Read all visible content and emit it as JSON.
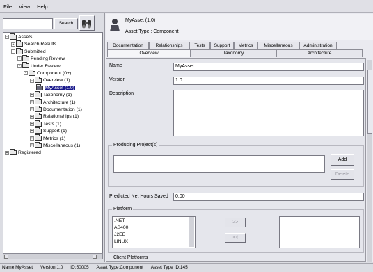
{
  "menu": [
    "File",
    "View",
    "Help"
  ],
  "search": {
    "button_label": "Search",
    "value": ""
  },
  "tree": [
    {
      "label": "Assets",
      "level": 0,
      "expander": "-"
    },
    {
      "label": "Search Results",
      "level": 1,
      "expander": "+"
    },
    {
      "label": "Submitted",
      "level": 1,
      "expander": "-"
    },
    {
      "label": "Pending Review",
      "level": 2,
      "expander": "+"
    },
    {
      "label": "Under Review",
      "level": 2,
      "expander": "-"
    },
    {
      "label": "Component (0+)",
      "level": 3,
      "expander": "-"
    },
    {
      "label": "Overview (1)",
      "level": 4,
      "expander": "-"
    },
    {
      "label": "MyAsset (1.0)",
      "level": 5,
      "expander": "",
      "selected": true
    },
    {
      "label": "Taxonomy (1)",
      "level": 4,
      "expander": "+"
    },
    {
      "label": "Architecture (1)",
      "level": 4,
      "expander": "+"
    },
    {
      "label": "Documentation (1)",
      "level": 4,
      "expander": "+"
    },
    {
      "label": "Relationships (1)",
      "level": 4,
      "expander": "+"
    },
    {
      "label": "Tests (1)",
      "level": 4,
      "expander": "+"
    },
    {
      "label": "Support (1)",
      "level": 4,
      "expander": "+"
    },
    {
      "label": "Metrics (1)",
      "level": 4,
      "expander": "+"
    },
    {
      "label": "Miscellaneous (1)",
      "level": 4,
      "expander": "+"
    },
    {
      "label": "Registered",
      "level": 0,
      "expander": "+"
    }
  ],
  "asset": {
    "title": "MyAsset (1.0)",
    "type_line": "Asset Type : Component"
  },
  "tabs_back": [
    "Documentation",
    "Relationships",
    "Tests",
    "Support",
    "Metrics",
    "Miscellaneous",
    "Administration"
  ],
  "tabs_front": [
    "Overview",
    "Taxonomy",
    "Architecture"
  ],
  "form": {
    "name_label": "Name",
    "name_value": "MyAsset",
    "version_label": "Version",
    "version_value": "1.0",
    "description_label": "Description",
    "description_value": "",
    "projects_label": "Producing Project(s)",
    "add_label": "Add",
    "delete_label": "Delete",
    "hours_label": "Predicted Net Hours Saved",
    "hours_value": "0.00",
    "platform_label": "Platform",
    "platforms": [
      ".NET",
      "AS400",
      "J2EE",
      "LINUX"
    ],
    "move_right_label": ">>",
    "move_left_label": "<<",
    "client_platforms_label": "Client Platforms"
  },
  "status": {
    "name": "Name:MyAsset",
    "version": "Version:1.0",
    "id": "ID:50005",
    "asset_type": "Asset Type:Component",
    "asset_type_id": "Asset Type ID:145"
  }
}
